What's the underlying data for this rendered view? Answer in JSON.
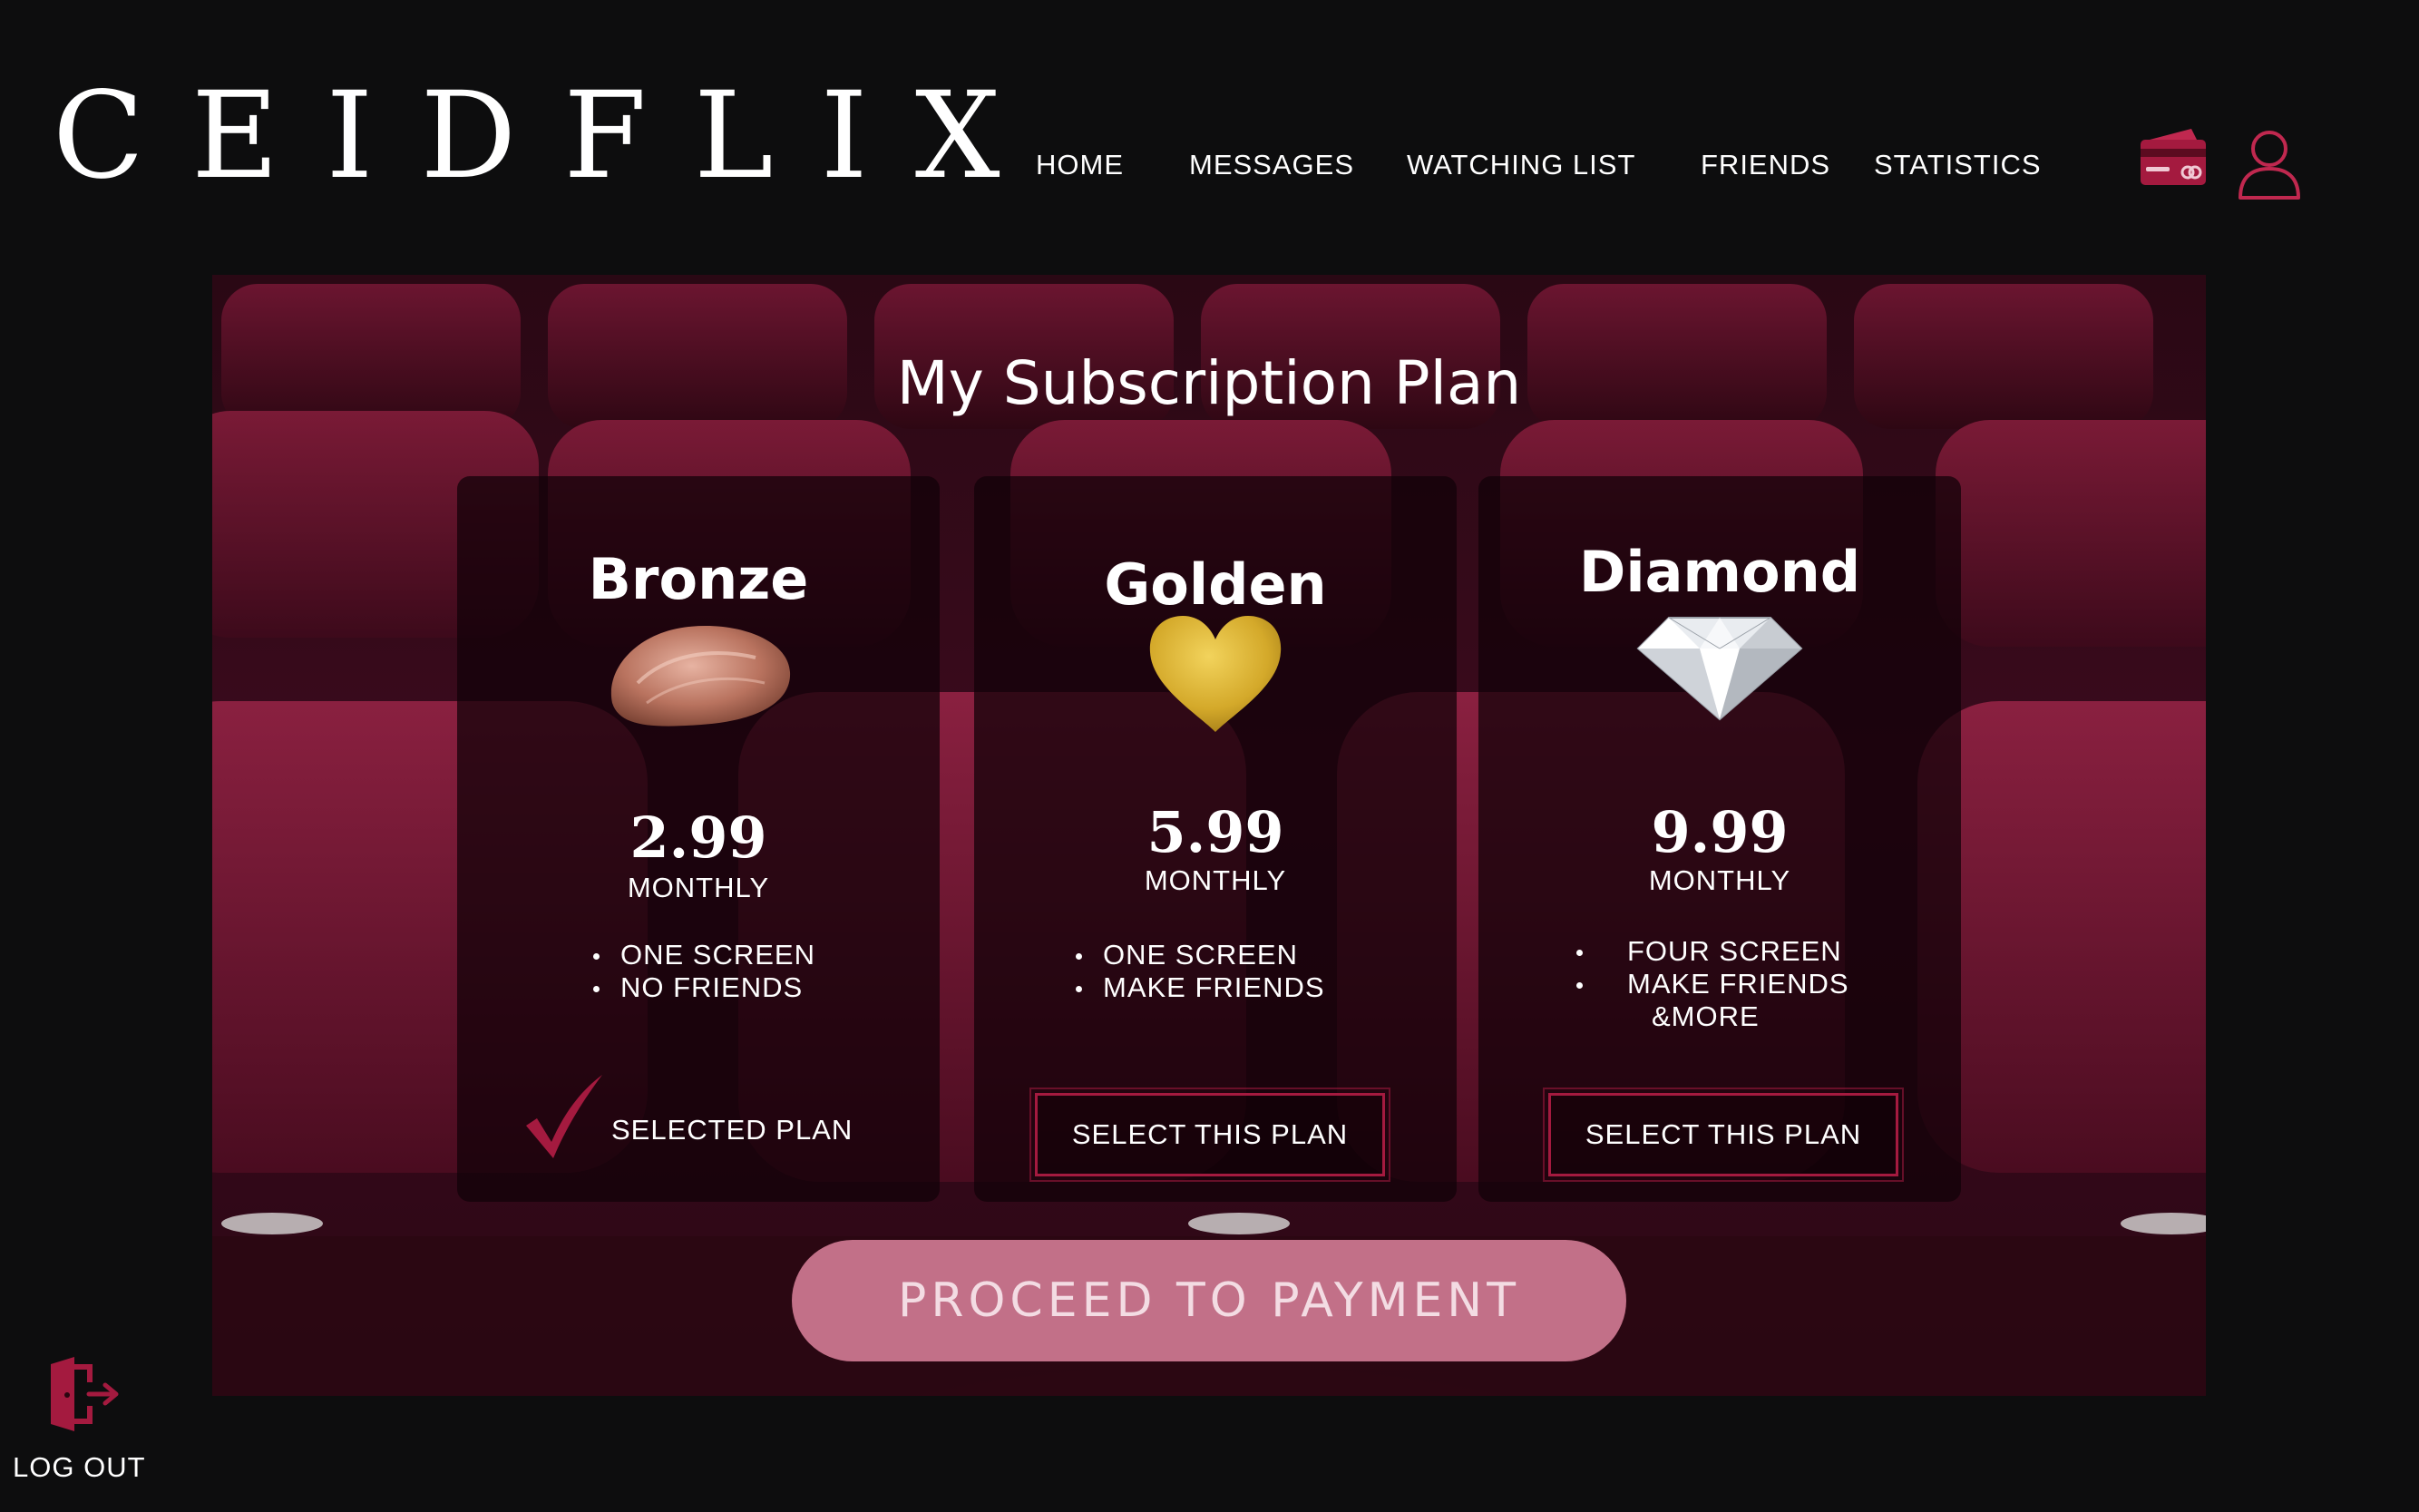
{
  "app": {
    "logo": "CEIDFLIX"
  },
  "nav": {
    "home": "HOME",
    "messages": "MESSAGES",
    "watching_list": "WATCHING LIST",
    "friends": "FRIENDS",
    "statistics": "STATISTICS"
  },
  "header_icons": {
    "payment": "credit-card-icon",
    "profile": "user-icon"
  },
  "page": {
    "title": "My Subscription Plan"
  },
  "plans": [
    {
      "name": "Bronze",
      "emblem": "bronze-nugget-icon",
      "price": "2.99",
      "period": "MONTHLY",
      "features": [
        "ONE SCREEN",
        "NO FRIENDS"
      ],
      "status": "SELECTED PLAN"
    },
    {
      "name": "Golden",
      "emblem": "golden-heart-icon",
      "price": "5.99",
      "period": "MONTHLY",
      "features": [
        "ONE SCREEN",
        "MAKE FRIENDS"
      ],
      "action": "SELECT THIS PLAN"
    },
    {
      "name": "Diamond",
      "emblem": "diamond-icon",
      "price": "9.99",
      "period": "MONTHLY",
      "features": [
        "FOUR SCREEN",
        "MAKE FRIENDS",
        "&MORE"
      ],
      "action": "SELECT THIS PLAN"
    }
  ],
  "proceed": {
    "label": "PROCEED TO PAYMENT"
  },
  "logout": {
    "label": "LOG OUT",
    "icon": "logout-door-icon"
  },
  "colors": {
    "background": "#0d0d0e",
    "accent": "#a41a3f",
    "proceed_button": "#c27088",
    "theater_red": "#3b0b1d"
  }
}
